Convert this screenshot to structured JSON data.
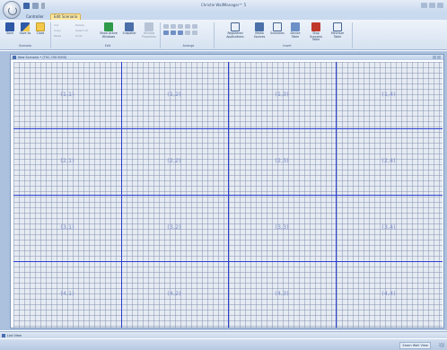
{
  "app": {
    "title": "Christie WallManager™ 5"
  },
  "tabs": [
    {
      "label": "Controller"
    },
    {
      "label": "Edit Scenario"
    }
  ],
  "ribbon": {
    "scenario_group": {
      "label": "Scenario",
      "buttons": [
        {
          "label": "Save",
          "icon": "save-icon"
        },
        {
          "label": "Save As",
          "icon": "save-as-icon"
        },
        {
          "label": "Close",
          "icon": "folder-close-icon"
        }
      ]
    },
    "edit_group": {
      "label": "Edit",
      "small_items": [
        "Cut",
        "Copy",
        "Paste",
        "Delete",
        "Select All",
        "Undo"
      ],
      "buttons": [
        {
          "label": "Show Active Windows",
          "icon": "windows-icon"
        },
        {
          "label": "Snapshot",
          "icon": "snapshot-icon"
        },
        {
          "label": "Window Properties",
          "icon": "window-properties-icon"
        }
      ]
    },
    "arrange_group": {
      "label": "Arrange"
    },
    "insert_group": {
      "label": "Insert",
      "buttons": [
        {
          "label": "Registered Applications",
          "icon": "registered-apps-icon"
        },
        {
          "label": "Media Sources",
          "icon": "media-sources-icon"
        },
        {
          "label": "Scenarios",
          "icon": "scenarios-icon"
        },
        {
          "label": "Device Table",
          "icon": "device-table-icon"
        },
        {
          "label": "Stop Scenario Table",
          "icon": "stop-scenario-icon"
        },
        {
          "label": "Minimize Table",
          "icon": "minimize-table-icon"
        }
      ]
    }
  },
  "document": {
    "title": "New Scenario • (TVC-700 0000)",
    "grid": {
      "rows": 4,
      "cols": 4,
      "cells": [
        [
          "(1,1)",
          "(1,2)",
          "(1,3)",
          "(1,4)"
        ],
        [
          "(2,1)",
          "(2,2)",
          "(2,3)",
          "(2,4)"
        ],
        [
          "(3,1)",
          "(3,2)",
          "(3,3)",
          "(3,4)"
        ],
        [
          "(4,1)",
          "(4,2)",
          "(4,3)",
          "(4,4)"
        ]
      ],
      "divider_color": "#2b3fd0",
      "grid_color": "#e6ebf2"
    }
  },
  "list_view": {
    "label": "List View"
  },
  "status": {
    "zoom_label": "Zoom Wall View"
  }
}
